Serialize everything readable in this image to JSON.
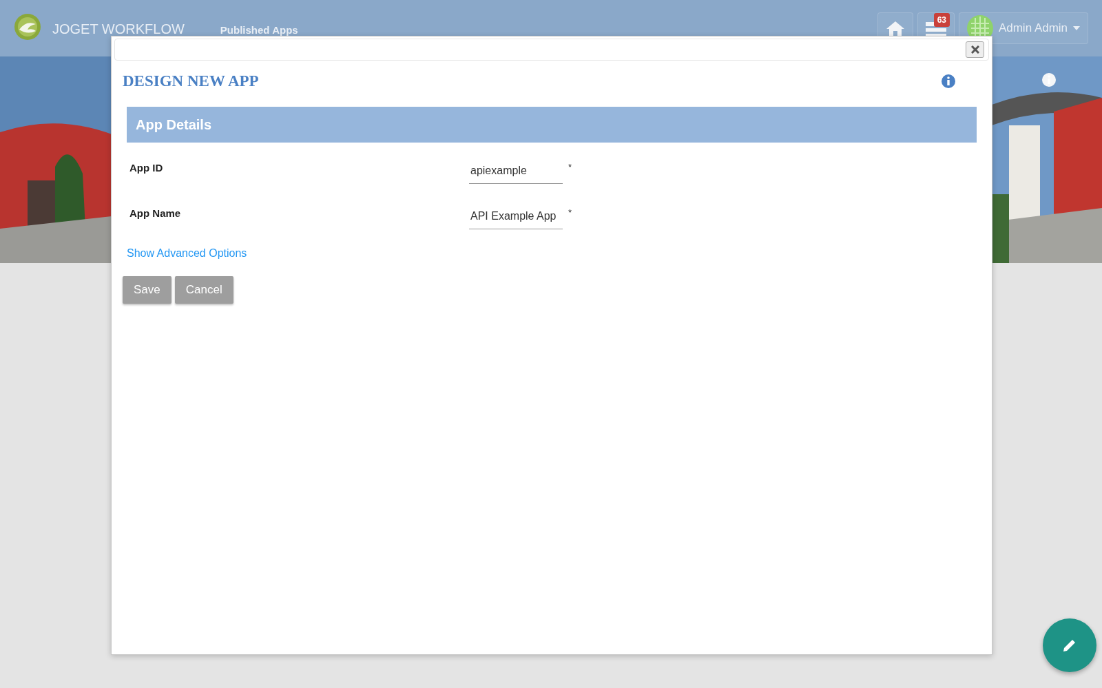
{
  "header": {
    "brand": "JOGET WORKFLOW",
    "nav": "Published Apps",
    "notification_count": "63",
    "user": "Admin Admin"
  },
  "dialog": {
    "title": "DESIGN NEW APP",
    "section": "App Details",
    "fields": [
      {
        "label": "App ID",
        "value": "apiexample",
        "required_mark": "*"
      },
      {
        "label": "App Name",
        "value": "API Example App",
        "required_mark": "*"
      }
    ],
    "advanced_link": "Show Advanced Options",
    "buttons": [
      "Save",
      "Cancel"
    ]
  }
}
